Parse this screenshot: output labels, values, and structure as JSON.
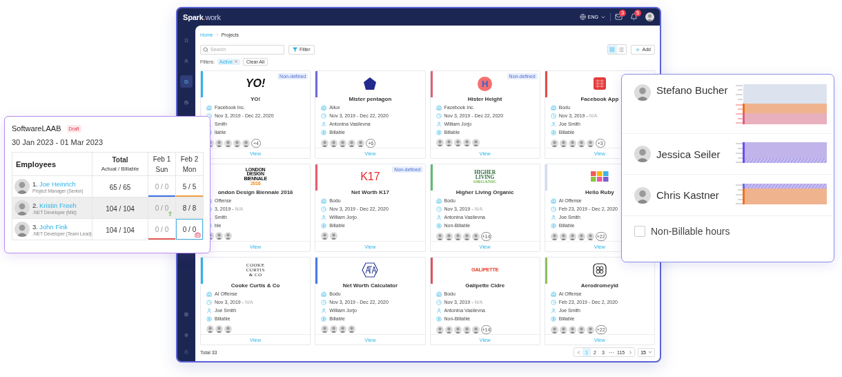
{
  "app": {
    "brand": [
      "Spark",
      ".",
      "work"
    ],
    "language": "ENG",
    "mail_badge": "3",
    "bell_badge": "5",
    "sidebar": {
      "top": [
        {
          "kind": "bookmark",
          "selected": false
        },
        {
          "kind": "team",
          "selected": false
        },
        {
          "kind": "briefcase",
          "selected": true
        },
        {
          "kind": "calendar",
          "selected": false
        }
      ],
      "bottom": [
        {
          "kind": "dashboard",
          "selected": false
        },
        {
          "kind": "settings",
          "selected": false
        }
      ],
      "footer": "©"
    },
    "breadcrumb": [
      "Home",
      "Projects"
    ],
    "search": {
      "placeholder": "Search"
    },
    "filter_button": "Filter",
    "filters_label": "Filters:",
    "filter_chips": [
      {
        "label": "Active"
      }
    ],
    "clear_all": "Clear All",
    "view_modes": [
      {
        "kind": "grid",
        "selected": true
      },
      {
        "kind": "list",
        "selected": false
      }
    ],
    "add_button": "Add",
    "cards": [
      {
        "logo": {
          "kind": "italic-wordmark",
          "lines": [
            "YO!"
          ]
        },
        "badge": "Non-defined",
        "title": "YO!",
        "color": "#2bb3e6",
        "client": "Facebook Inc.",
        "start": "Nov 3, 2019 -",
        "end": "Dec 22, 2020",
        "end_known": true,
        "owner": "Smith",
        "billing": "llable",
        "avatars": [
          {
            "kind": "person"
          },
          {
            "kind": "person"
          },
          {
            "kind": "person"
          },
          {
            "kind": "person"
          },
          {
            "kind": "person"
          }
        ],
        "more": "+4",
        "view": "View"
      },
      {
        "logo": {
          "kind": "pentagon"
        },
        "title": "Mister pentagon",
        "color": "#6b6bdc",
        "client": "Ailux",
        "start": "Nov 3, 2019 -",
        "end": "Dec 22, 2020",
        "end_known": true,
        "owner": "Antonina Vasilevna",
        "billing": "Billable",
        "avatars": [
          {
            "kind": "person"
          },
          {
            "kind": "person"
          },
          {
            "kind": "person"
          },
          {
            "kind": "person"
          },
          {
            "kind": "person"
          }
        ],
        "more": "+6",
        "view": "View"
      },
      {
        "logo": {
          "kind": "circle-letter",
          "lines": [
            "H"
          ]
        },
        "badge": "Non-defined",
        "title": "Hister Height",
        "color": "#e06070",
        "client": "Facebook Inc.",
        "start": "Nov 3, 2019 -",
        "end": "Dec 22, 2020",
        "end_known": true,
        "owner": "William Jorjo",
        "billing": "Billable",
        "avatars": [
          {
            "kind": "person"
          },
          {
            "kind": "person"
          },
          {
            "kind": "person"
          },
          {
            "kind": "person"
          },
          {
            "kind": "person"
          }
        ],
        "view": "View"
      },
      {
        "logo": {
          "kind": "stamp"
        },
        "title": "Facebook App",
        "color": "#e04b4b",
        "client": "Bodu",
        "start": "Nov 3, 2019 -",
        "end": "N/A",
        "end_known": false,
        "owner": "Joe Smith",
        "billing": "Billable",
        "avatars": [
          {
            "kind": "person"
          },
          {
            "kind": "person"
          },
          {
            "kind": "person"
          },
          {
            "kind": "person"
          },
          {
            "kind": "person"
          }
        ],
        "more": "+3",
        "view": "View"
      },
      {
        "logo": {
          "kind": "london-stack",
          "lines": [
            "LONDON",
            "DESIGN",
            "BIENNALE",
            "2016"
          ]
        },
        "title": "ondon Design Biennale 2016",
        "client": "Offense",
        "start": "3, 2019 -",
        "end": "N/A",
        "end_known": false,
        "owner": "Smith",
        "billing": "ble",
        "avatars": [
          {
            "kind": "person"
          },
          {
            "kind": "person"
          },
          {
            "kind": "person"
          }
        ],
        "view": "View"
      },
      {
        "logo": {
          "kind": "red-wordmark",
          "lines": [
            "K17"
          ]
        },
        "badge": "Non-defined",
        "title": "Net Worth K17",
        "color": "#e85c6c",
        "client": "Bodu",
        "start": "Nov 3, 2019 -",
        "end": "Dec 22, 2020",
        "end_known": true,
        "owner": "William Jorjo",
        "billing": "Billable",
        "avatars": [
          {
            "kind": "person"
          },
          {
            "kind": "person"
          }
        ],
        "view": "View"
      },
      {
        "logo": {
          "kind": "green-stack",
          "lines": [
            "HIGHER",
            "LIVING",
            "ORGANIC"
          ]
        },
        "title": "Higher Living Organic",
        "color": "#5bbd6b",
        "client": "Bodu",
        "start": "Nov 3, 2019 -",
        "end": "N/A",
        "end_known": false,
        "owner": "Antonina Vasilevna",
        "billing": "Non-Billable",
        "avatars": [
          {
            "kind": "person"
          },
          {
            "kind": "person"
          },
          {
            "kind": "person"
          },
          {
            "kind": "person"
          },
          {
            "kind": "person"
          }
        ],
        "more": "+14",
        "view": "View"
      },
      {
        "logo": {
          "kind": "blocks"
        },
        "title": "Hello Ruby",
        "color": "#d3dcee",
        "client": "AI Offense",
        "start": "Feb 23, 2019 -",
        "end": "Dec 2, 2020",
        "end_known": true,
        "owner": "Joe Smith",
        "billing": "Billable",
        "avatars": [
          {
            "kind": "person"
          },
          {
            "kind": "person"
          },
          {
            "kind": "person"
          },
          {
            "kind": "person"
          },
          {
            "kind": "person"
          }
        ],
        "more": "+22",
        "view": "View"
      },
      {
        "logo": {
          "kind": "serif-stack",
          "lines": [
            "COOKE",
            "CURTIS",
            "& CO"
          ]
        },
        "title": "Cooke Curtis & Co",
        "color": "#2bb3e6",
        "client": "AI Offense",
        "start": "Nov 3, 2019 -",
        "end": "N/A",
        "end_known": false,
        "owner": "Joe Smith",
        "billing": "Billable",
        "avatars": [
          {
            "kind": "person"
          },
          {
            "kind": "person"
          },
          {
            "kind": "person"
          }
        ],
        "view": "View"
      },
      {
        "logo": {
          "kind": "hexagon"
        },
        "title": "Net Worth Calculator",
        "color": "#4a7ae8",
        "client": "Bodu",
        "start": "Nov 3, 2019 -",
        "end": "Dec 22, 2020",
        "end_known": true,
        "owner": "William Jorjo",
        "billing": "Billable",
        "avatars": [
          {
            "kind": "person"
          },
          {
            "kind": "person"
          },
          {
            "kind": "person"
          },
          {
            "kind": "person"
          }
        ],
        "view": "View"
      },
      {
        "logo": {
          "kind": "red-caps",
          "lines": [
            "GALIPETTE"
          ]
        },
        "title": "Galipette Cidre",
        "color": "#e05060",
        "client": "Bodu",
        "start": "Nov 3, 2019 -",
        "end": "N/A",
        "end_known": false,
        "owner": "Antonina Vasilevna",
        "billing": "Non-Billable",
        "avatars": [
          {
            "kind": "person"
          },
          {
            "kind": "person"
          },
          {
            "kind": "person"
          },
          {
            "kind": "person"
          },
          {
            "kind": "person"
          }
        ],
        "more": "+14",
        "view": "View"
      },
      {
        "logo": {
          "kind": "rounded-grid"
        },
        "title": "Aerodromeyid",
        "color": "#8fc05a",
        "client": "AI Offense",
        "start": "Feb 23, 2019 -",
        "end": "Dec 2, 2020",
        "end_known": true,
        "owner": "Joe Smith",
        "billing": "Billable",
        "avatars": [
          {
            "kind": "person"
          },
          {
            "kind": "person"
          },
          {
            "kind": "person"
          },
          {
            "kind": "person"
          },
          {
            "kind": "person"
          }
        ],
        "more": "+22",
        "view": "View"
      }
    ],
    "total": "Total 33",
    "pages": [
      {
        "label": "1",
        "selected": true
      },
      {
        "label": "2",
        "selected": false
      },
      {
        "label": "3",
        "selected": false
      },
      {
        "label": "···",
        "selected": false
      },
      {
        "label": "115",
        "selected": false
      }
    ],
    "page_size": "15"
  },
  "timesheet": {
    "title": "SoftwareLAAB",
    "status": "Draft",
    "period": "30 Jan 2023 - 01 Mar 2023",
    "columns": {
      "employees": "Employees",
      "total": "Total",
      "total_sub": "Actual / Billable",
      "days": [
        {
          "date": "Feb 1",
          "weekday": "Sun",
          "weekend": true
        },
        {
          "date": "Feb 2",
          "weekday": "Mon",
          "weekend": false
        }
      ]
    },
    "rows": [
      {
        "index": "1.",
        "name": "Joe Heinrich",
        "role": "Project Manager (Senior)",
        "total": "65 / 65",
        "highlighted": false,
        "cells": [
          {
            "value": "0 / 0",
            "kind": "plain",
            "color": "#3b6fe8",
            "selected": false
          },
          {
            "value": "5 / 5",
            "kind": "plain",
            "color": "#f0a040",
            "selected": false
          }
        ]
      },
      {
        "index": "2.",
        "name": "Kristin Freeh",
        "role": ".NET Developer (Mid)",
        "total": "104 / 104",
        "highlighted": true,
        "cells": [
          {
            "value": "0 / 0",
            "kind": "leave",
            "selected": false
          },
          {
            "value": "8 / 8",
            "kind": "plain",
            "selected": false
          }
        ]
      },
      {
        "index": "3.",
        "name": "John Fink",
        "role": ".NET Developer (Team Lead)",
        "total": "104 / 104",
        "highlighted": false,
        "cells": [
          {
            "value": "0 / 0",
            "kind": "plain",
            "color": "#e85a5a",
            "selected": false
          },
          {
            "value": "0 / 0",
            "kind": "sick",
            "selected": true
          }
        ]
      }
    ]
  },
  "utilization": {
    "people": [
      {
        "name": "Stefano Bucher",
        "kind": "three-band"
      },
      {
        "name": "Jessica Seiler",
        "kind": "hatched-bottom"
      },
      {
        "name": "Chris Kastner",
        "kind": "hatched-top"
      }
    ],
    "option": {
      "label": "Non-Billable hours",
      "checked": false
    }
  }
}
